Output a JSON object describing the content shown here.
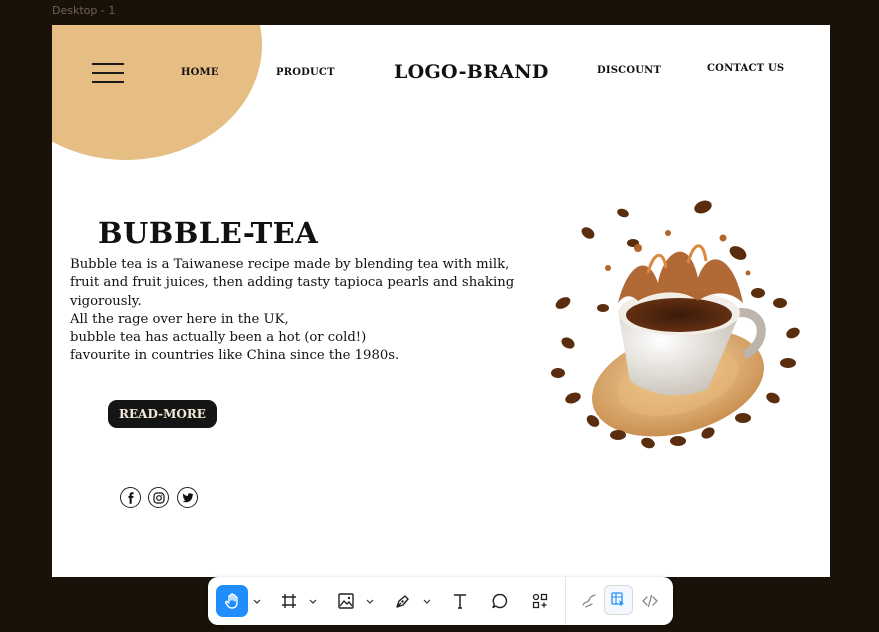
{
  "editor": {
    "frame_label": "Desktop - 1"
  },
  "header": {
    "nav_home": "HOME",
    "nav_product": "PRODUCT",
    "logo": "LOGO-BRAND",
    "nav_discount": "DISCOUNT",
    "nav_contact": "CONTACT US"
  },
  "hero": {
    "title": "BUBBLE-TEA",
    "lines": [
      "Bubble tea is a Taiwanese recipe made by blending tea with milk,",
      "fruit and fruit juices, then adding tasty tapioca pearls and shaking",
      "vigorously.",
      "All the rage over here in the UK,",
      "bubble tea has actually been a hot (or cold!)",
      "favourite in countries like China since the 1980s."
    ],
    "button_label": "READ-MORE"
  },
  "social_icons": [
    "facebook-icon",
    "instagram-icon",
    "twitter-icon"
  ],
  "toolbar_tools": [
    "hand-tool",
    "frame-tool",
    "image-tool",
    "pen-tool",
    "text-tool",
    "comment-tool",
    "components-tool",
    "draw-mode",
    "design-mode",
    "dev-mode"
  ],
  "colors": {
    "canvas_bg": "#1a1208",
    "accent_blob": "#e6bd82",
    "button_bg": "#151515",
    "toolbar_active": "#1f8efb"
  }
}
